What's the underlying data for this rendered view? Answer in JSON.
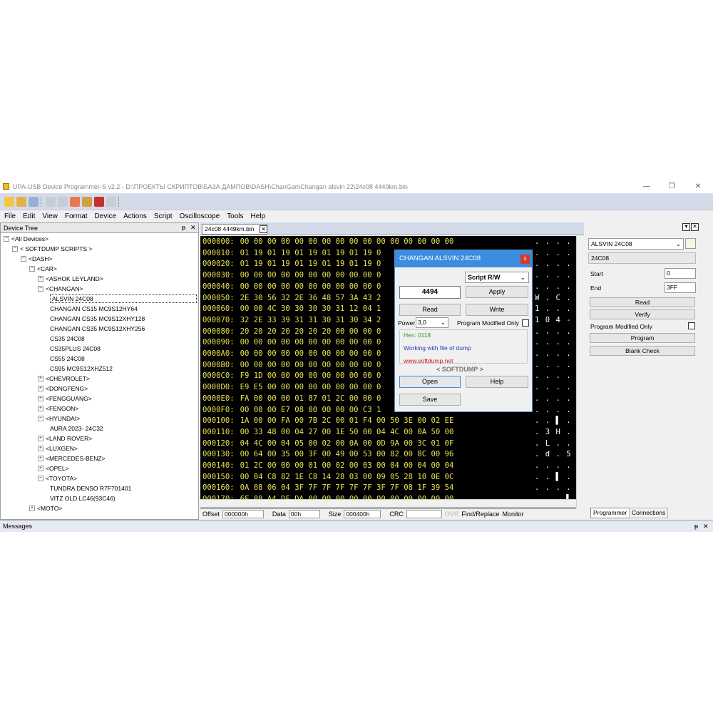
{
  "window": {
    "title": "UPA-USB Device Programmer-S v2.2 - D:\\ПРОЕКТЫ СКРИПТОВ\\БАЗА ДАМПОВ\\DASH\\ChanGan\\Changan alsvin 22\\24c08 4449km.bin",
    "minimize": "—",
    "restore": "❐",
    "close": "✕"
  },
  "menu": [
    "File",
    "Edit",
    "View",
    "Format",
    "Device",
    "Actions",
    "Script",
    "Oscilloscope",
    "Tools",
    "Help"
  ],
  "device_tree": {
    "title": "Device Tree",
    "pin": "ᵽ",
    "close": "✕",
    "items": [
      {
        "label": "<All Devices>",
        "indent": 0,
        "exp": "minus"
      },
      {
        "label": "< SOFTDUMP SCRIPTS >",
        "indent": 1,
        "exp": "minus"
      },
      {
        "label": "<DASH>",
        "indent": 2,
        "exp": "minus"
      },
      {
        "label": "<CAR>",
        "indent": 3,
        "exp": "minus"
      },
      {
        "label": "<ASHOK LEYLAND>",
        "indent": 4,
        "exp": "plus"
      },
      {
        "label": "<CHANGAN>",
        "indent": 4,
        "exp": "minus"
      },
      {
        "label": "ALSVIN 24C08",
        "indent": 5,
        "exp": "none",
        "selected": true
      },
      {
        "label": "CHANGAN CS15 MC9S12HY64",
        "indent": 5,
        "exp": "none"
      },
      {
        "label": "CHANGAN CS35 MC9S12XHY128",
        "indent": 5,
        "exp": "none"
      },
      {
        "label": "CHANGAN CS35 MC9S12XHY256",
        "indent": 5,
        "exp": "none"
      },
      {
        "label": "CS35 24C08",
        "indent": 5,
        "exp": "none"
      },
      {
        "label": "CS35PLUS 24C08",
        "indent": 5,
        "exp": "none"
      },
      {
        "label": "CS55 24C08",
        "indent": 5,
        "exp": "none"
      },
      {
        "label": "CS95 MC9S12XHZ512",
        "indent": 5,
        "exp": "none"
      },
      {
        "label": "<CHEVROLET>",
        "indent": 4,
        "exp": "plus"
      },
      {
        "label": "<DONGFENG>",
        "indent": 4,
        "exp": "plus"
      },
      {
        "label": "<FENGGUANG>",
        "indent": 4,
        "exp": "plus"
      },
      {
        "label": "<FENGON>",
        "indent": 4,
        "exp": "plus"
      },
      {
        "label": "<HYUNDAI>",
        "indent": 4,
        "exp": "minus"
      },
      {
        "label": "AURA 2023- 24C32",
        "indent": 5,
        "exp": "none"
      },
      {
        "label": "<LAND ROVER>",
        "indent": 4,
        "exp": "plus"
      },
      {
        "label": "<LUXGEN>",
        "indent": 4,
        "exp": "plus"
      },
      {
        "label": "<MERCEDES-BENZ>",
        "indent": 4,
        "exp": "plus"
      },
      {
        "label": "<OPEL>",
        "indent": 4,
        "exp": "plus"
      },
      {
        "label": "<TOYOTA>",
        "indent": 4,
        "exp": "minus"
      },
      {
        "label": "TUNDRA DENSO R7F701401",
        "indent": 5,
        "exp": "none"
      },
      {
        "label": "VITZ OLD LC46(93C46)",
        "indent": 5,
        "exp": "none"
      },
      {
        "label": "<MOTO>",
        "indent": 3,
        "exp": "plus"
      }
    ]
  },
  "file_tab": {
    "label": "24c08 4449km.bin",
    "close": "✕"
  },
  "hex_rows": [
    {
      "addr": "000000:",
      "bytes": "00 00 00 00 00 00 00 00 00 00 00 00 00 00 00 00",
      "ascii": ". . . . . . . . . . . . . . . ."
    },
    {
      "addr": "000010:",
      "bytes": "01 19 01 19 01 19 01 19 01 19 0",
      "ascii": ". . . . . . . ."
    },
    {
      "addr": "000020:",
      "bytes": "01 19 01 19 01 19 01 19 01 19 0",
      "ascii": ". . . . . . . ."
    },
    {
      "addr": "000030:",
      "bytes": "00 00 00 00 00 00 00 00 00 00 0",
      "ascii": ". . . . . . . ."
    },
    {
      "addr": "000040:",
      "bytes": "00 00 00 00 00 00 00 00 00 00 0",
      "ascii": ". . . . . . . ."
    },
    {
      "addr": "000050:",
      "bytes": "2E 30 56 32 2E 36 48 57 3A 43 2",
      "ascii": "W . C . 0"
    },
    {
      "addr": "000060:",
      "bytes": "00 00 4C 30 30 30 30 31 12 04 1",
      "ascii": "1 . . . V"
    },
    {
      "addr": "000070:",
      "bytes": "32 2E 33 39 31 31 30 31 30 34 2",
      "ascii": "1 0 4 - B"
    },
    {
      "addr": "000080:",
      "bytes": "20 20 20 20 20 20 20 00 00 00 0",
      "ascii": ". . . . . . . ."
    },
    {
      "addr": "000090:",
      "bytes": "00 00 00 00 00 00 00 00 00 00 0",
      "ascii": ". . . . . . . ."
    },
    {
      "addr": "0000A0:",
      "bytes": "00 00 00 00 00 00 00 00 00 00 0",
      "ascii": ". . . . . . . ."
    },
    {
      "addr": "0000B0:",
      "bytes": "00 00 00 00 00 00 00 00 00 00 0",
      "ascii": ". . . . . . . ."
    },
    {
      "addr": "0000C0:",
      "bytes": "F9 1D 00 00 00 00 00 00 00 00 0",
      "ascii": ". . . . . . . ."
    },
    {
      "addr": "0000D0:",
      "bytes": "E9 E5 00 00 00 00 00 00 00 00 0",
      "ascii": ". . . . . . . ."
    },
    {
      "addr": "0000E0:",
      "bytes": "FA 00 00 00 01 87 01 2C 00 00 0",
      "ascii": ". . . . . . . ."
    },
    {
      "addr": "0000F0:",
      "bytes": "00 00 00 E7 08 00 00 00 00 C3 1",
      "ascii": ". . . . ▌ . . ."
    },
    {
      "addr": "000100:",
      "bytes": "1A 00 00 FA 00 7B 2C 00 01 F4 00 50 3E 00 02 EE",
      "ascii": ". . ▌ . { . . . ▌ . P"
    },
    {
      "addr": "000110:",
      "bytes": "00 33 48 00 04 27 00 1E 50 00 04 4C 00 0A 50 00",
      "ascii": ". 3 H . . ' . . P . . L"
    },
    {
      "addr": "000120:",
      "bytes": "04 4C 00 04 05 00 02 00 0A 00 0D 9A 00 3C 01 0F",
      "ascii": ". L . . . . . . . . . ."
    },
    {
      "addr": "000130:",
      "bytes": "00 64 00 35 00 3F 00 49 00 53 00 82 00 8C 00 96",
      "ascii": ". d . 5 . ? . I . S . ."
    },
    {
      "addr": "000140:",
      "bytes": "01 2C 00 00 00 01 00 02 00 03 00 04 00 04 00 04",
      "ascii": ". . . . . . . . . . . ."
    },
    {
      "addr": "000150:",
      "bytes": "00 04 C8 82 1E C8 14 28 03 00 09 05 28 10 0E 0C",
      "ascii": ". . ▌ . . ▌ . ( . . . ."
    },
    {
      "addr": "000160:",
      "bytes": "0A 08 06 04 3F 7F 7F 7F 7F 7F 3F 7F 08 1F 39 54",
      "ascii": ". . . . ? ▯ ▯ ▯ ▯ ▯ ? ▯"
    },
    {
      "addr": "000170:",
      "bytes": "6F 88 A4 DF DA 00 00 00 00 00 00 00 00 00 00 00",
      "ascii": ". . . ▌ ▌ . . . . . . ."
    }
  ],
  "status": {
    "offset_label": "Offset",
    "offset_value": "000000h",
    "data_label": "Data",
    "data_value": "00h",
    "size_label": "Size",
    "size_value": "000400h",
    "crc_label": "CRC",
    "crc_value": "",
    "ovr": "OVR",
    "find_replace": "Find/Replace",
    "monitor": "Monitor"
  },
  "right_panel": {
    "device_select": "ALSVIN 24C08",
    "device_name": "24C08",
    "start_label": "Start",
    "start_value": "0",
    "end_label": "End",
    "end_value": "3FF",
    "read": "Read",
    "verify": "Verify",
    "program_modified_only": "Program Modified Only",
    "program": "Program",
    "blank_check": "Blank Check",
    "tab_programmer": "Programmer",
    "tab_connections": "Connections"
  },
  "messages": {
    "title": "Messages"
  },
  "dialog": {
    "title": "CHANGAN ALSVIN 24C08",
    "close": "x",
    "script_select": "Script R/W",
    "value": "4494",
    "apply": "Apply",
    "read": "Read",
    "write": "Write",
    "power_label": "Power",
    "power_value": "3,0",
    "program_modified_only": "Program Modified Only",
    "hex_info": "Hex: 0118",
    "working": "Working with file of dump",
    "website": "www.softdump.net",
    "brand": "< SOFTDUMP >",
    "open": "Open",
    "help": "Help",
    "save": "Save"
  },
  "colors": {
    "hex_bg": "#000000",
    "hex_text": "#e8e050",
    "dialog_title": "#3c8ce0",
    "toolbar_bg": "#d4dbe8",
    "link_red": "#c82020",
    "info_green": "#2a9a2a",
    "info_blue": "#2040c0"
  }
}
